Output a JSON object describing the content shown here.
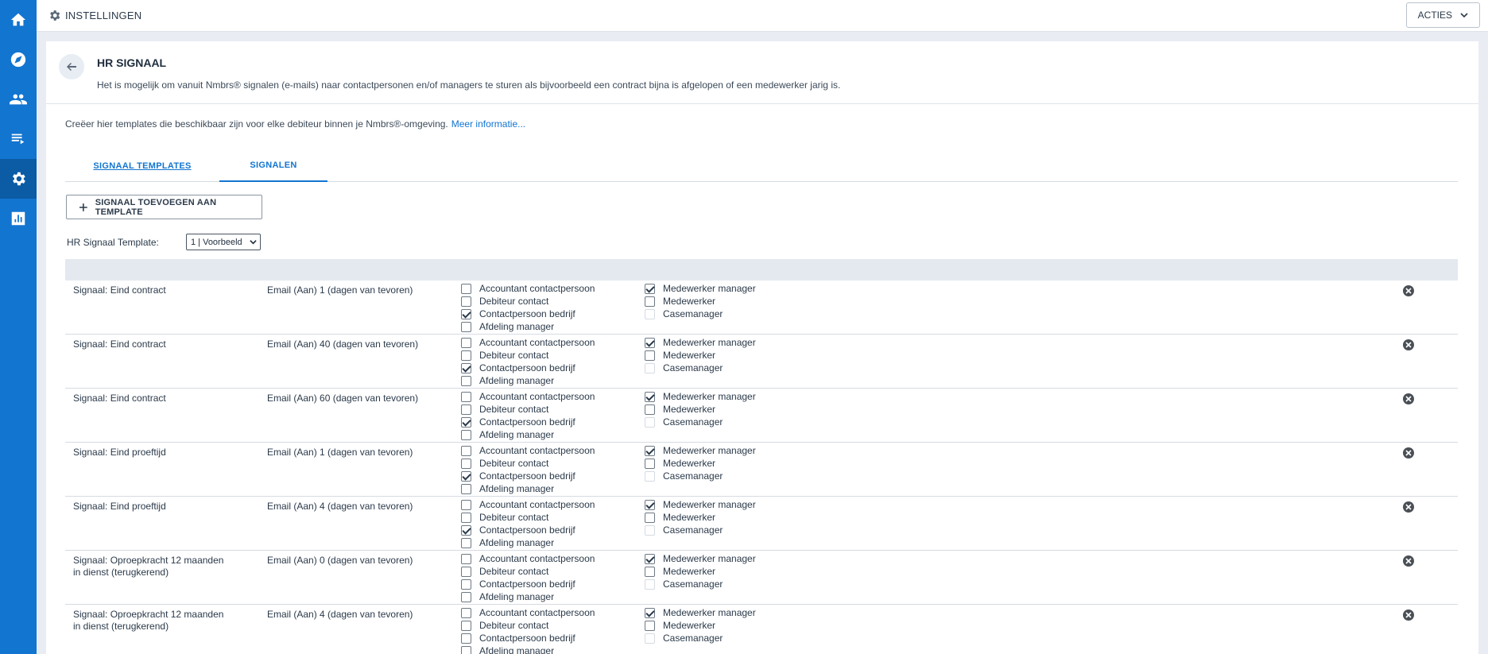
{
  "sidebar": {
    "items": [
      {
        "icon": "home-icon",
        "active": false
      },
      {
        "icon": "compass-icon",
        "active": false
      },
      {
        "icon": "people-icon",
        "active": false
      },
      {
        "icon": "list-icon",
        "active": false
      },
      {
        "icon": "gear-icon",
        "active": true
      },
      {
        "icon": "chart-icon",
        "active": false
      }
    ]
  },
  "topbar": {
    "breadcrumb": "INSTELLINGEN",
    "actions_label": "ACTIES"
  },
  "header": {
    "title": "HR SIGNAAL",
    "description": "Het is mogelijk om vanuit Nmbrs® signalen (e-mails) naar contactpersonen en/of managers te sturen als bijvoorbeeld een contract bijna is afgelopen of een medewerker jarig is."
  },
  "info": {
    "text": "Creëer hier templates die beschikbaar zijn voor elke debiteur binnen je Nmbrs®-omgeving.",
    "link": "Meer informatie..."
  },
  "tabs": [
    {
      "label": "SIGNAAL TEMPLATES",
      "active": false
    },
    {
      "label": "SIGNALEN",
      "active": true
    }
  ],
  "add_button_label": "SIGNAAL TOEVOEGEN AAN TEMPLATE",
  "template_select": {
    "label": "HR Signaal Template:",
    "value": "1 | Voorbeeld"
  },
  "recipients_col1": [
    "Accountant contactpersoon",
    "Debiteur contact",
    "Contactpersoon bedrijf",
    "Afdeling manager"
  ],
  "recipients_col2": [
    "Medewerker manager",
    "Medewerker",
    "Casemanager"
  ],
  "rows": [
    {
      "signal": "Signaal: Eind contract",
      "email": "Email (Aan) 1 (dagen van tevoren)",
      "col1_checked": [
        false,
        false,
        true,
        false
      ],
      "col2_checked": [
        true,
        false,
        false
      ],
      "casemanager_disabled": true
    },
    {
      "signal": "Signaal: Eind contract",
      "email": "Email (Aan) 40 (dagen van tevoren)",
      "col1_checked": [
        false,
        false,
        true,
        false
      ],
      "col2_checked": [
        true,
        false,
        false
      ],
      "casemanager_disabled": true
    },
    {
      "signal": "Signaal: Eind contract",
      "email": "Email (Aan) 60 (dagen van tevoren)",
      "col1_checked": [
        false,
        false,
        true,
        false
      ],
      "col2_checked": [
        true,
        false,
        false
      ],
      "casemanager_disabled": true
    },
    {
      "signal": "Signaal: Eind proeftijd",
      "email": "Email (Aan) 1 (dagen van tevoren)",
      "col1_checked": [
        false,
        false,
        true,
        false
      ],
      "col2_checked": [
        true,
        false,
        false
      ],
      "casemanager_disabled": true
    },
    {
      "signal": "Signaal: Eind proeftijd",
      "email": "Email (Aan) 4 (dagen van tevoren)",
      "col1_checked": [
        false,
        false,
        true,
        false
      ],
      "col2_checked": [
        true,
        false,
        false
      ],
      "casemanager_disabled": true
    },
    {
      "signal": "Signaal: Oproepkracht 12 maanden in dienst (terugkerend)",
      "email": "Email (Aan) 0 (dagen van tevoren)",
      "col1_checked": [
        false,
        false,
        false,
        false
      ],
      "col2_checked": [
        true,
        false,
        false
      ],
      "casemanager_disabled": true
    },
    {
      "signal": "Signaal: Oproepkracht 12 maanden in dienst (terugkerend)",
      "email": "Email (Aan) 4 (dagen van tevoren)",
      "col1_checked": [
        false,
        false,
        false,
        false
      ],
      "col2_checked": [
        true,
        false,
        false
      ],
      "casemanager_disabled": true
    }
  ]
}
